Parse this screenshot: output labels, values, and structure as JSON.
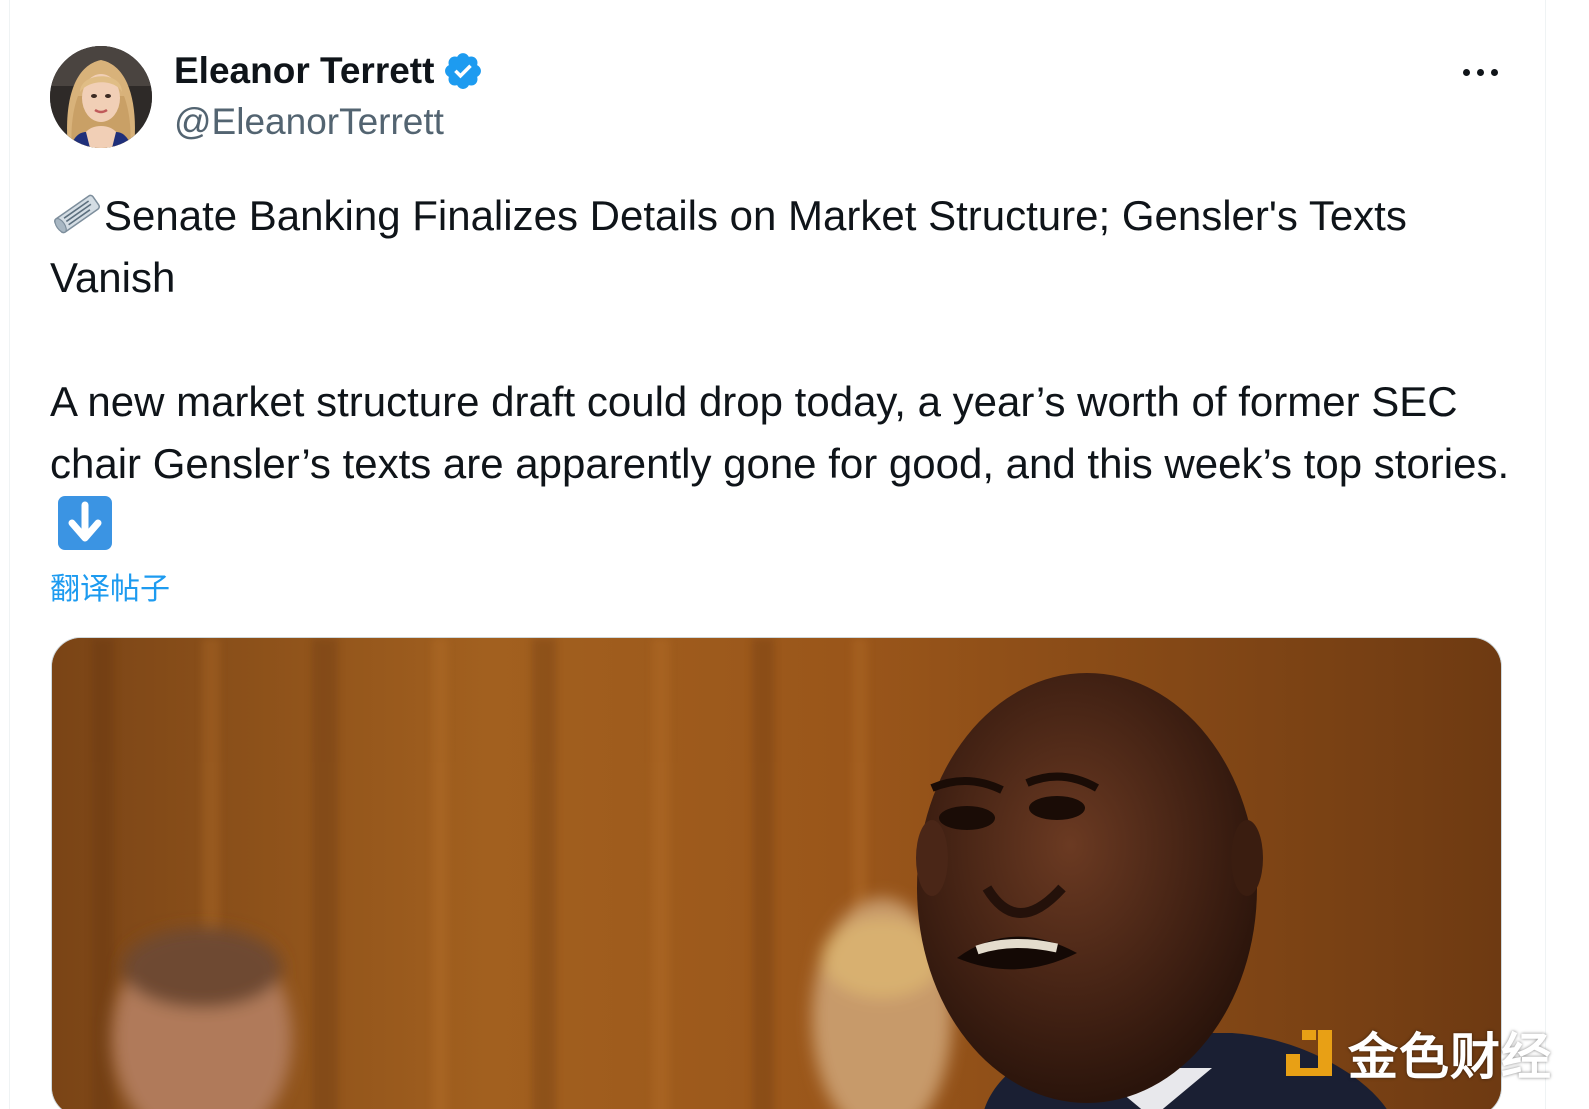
{
  "author": {
    "name": "Eleanor Terrett",
    "handle": "@EleanorTerrett",
    "verified": true,
    "verified_color": "#1d9bf0"
  },
  "tweet": {
    "title_icon": "newspaper-icon",
    "title": "Senate Banking Finalizes Details on Market Structure; Gensler's Texts Vanish",
    "body": "A new market structure draft could drop today, a year’s worth of former SEC chair Gensler’s texts are apparently gone for good, and this week’s top stories.",
    "body_end_icon": "down-arrow-icon",
    "translate_label": "翻译帖子"
  },
  "media": {
    "watermark_text": "金色财经"
  },
  "colors": {
    "text_primary": "#0f1419",
    "text_secondary": "#536471",
    "link": "#1d9bf0"
  }
}
